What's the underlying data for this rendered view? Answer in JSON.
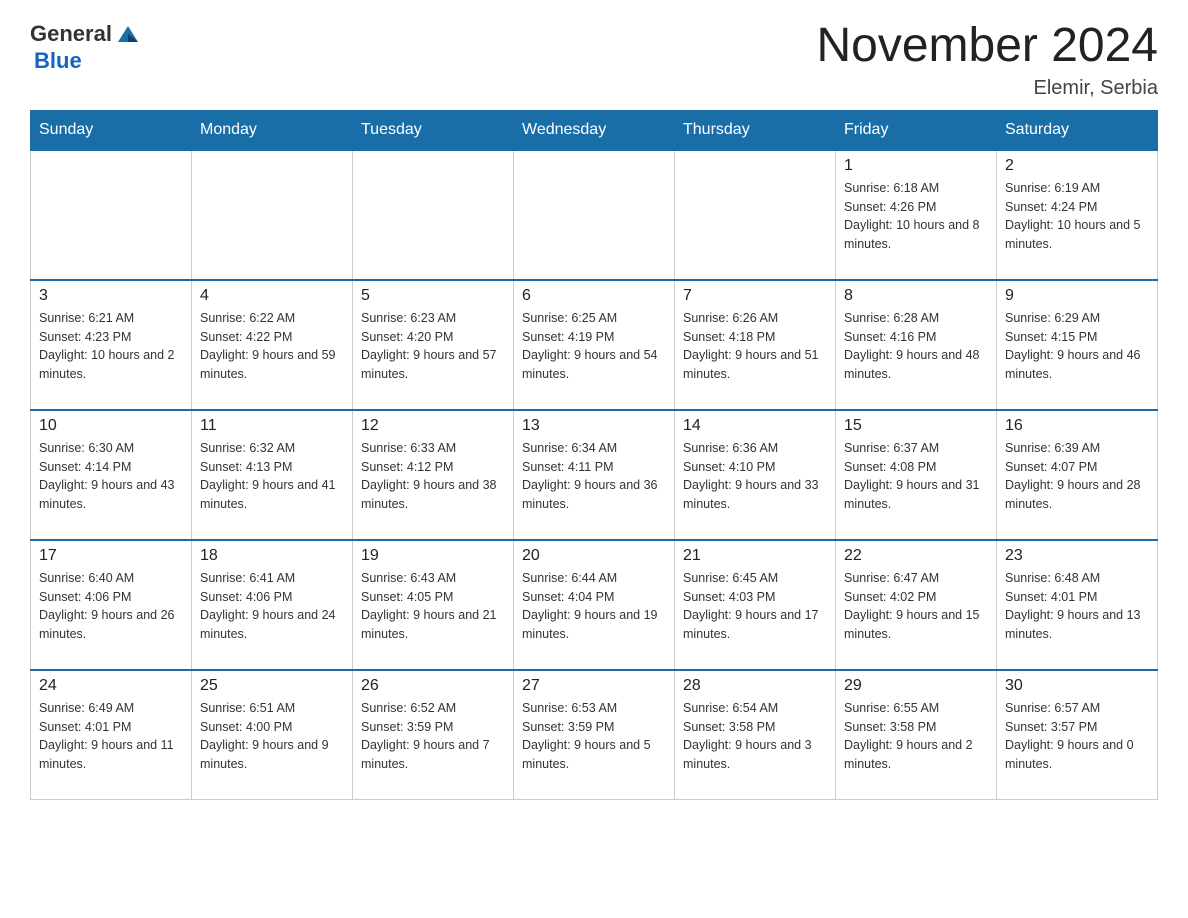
{
  "header": {
    "logo": {
      "general": "General",
      "blue": "Blue"
    },
    "title": "November 2024",
    "location": "Elemir, Serbia"
  },
  "weekdays": [
    "Sunday",
    "Monday",
    "Tuesday",
    "Wednesday",
    "Thursday",
    "Friday",
    "Saturday"
  ],
  "weeks": [
    [
      {
        "day": "",
        "info": ""
      },
      {
        "day": "",
        "info": ""
      },
      {
        "day": "",
        "info": ""
      },
      {
        "day": "",
        "info": ""
      },
      {
        "day": "",
        "info": ""
      },
      {
        "day": "1",
        "info": "Sunrise: 6:18 AM\nSunset: 4:26 PM\nDaylight: 10 hours and 8 minutes."
      },
      {
        "day": "2",
        "info": "Sunrise: 6:19 AM\nSunset: 4:24 PM\nDaylight: 10 hours and 5 minutes."
      }
    ],
    [
      {
        "day": "3",
        "info": "Sunrise: 6:21 AM\nSunset: 4:23 PM\nDaylight: 10 hours and 2 minutes."
      },
      {
        "day": "4",
        "info": "Sunrise: 6:22 AM\nSunset: 4:22 PM\nDaylight: 9 hours and 59 minutes."
      },
      {
        "day": "5",
        "info": "Sunrise: 6:23 AM\nSunset: 4:20 PM\nDaylight: 9 hours and 57 minutes."
      },
      {
        "day": "6",
        "info": "Sunrise: 6:25 AM\nSunset: 4:19 PM\nDaylight: 9 hours and 54 minutes."
      },
      {
        "day": "7",
        "info": "Sunrise: 6:26 AM\nSunset: 4:18 PM\nDaylight: 9 hours and 51 minutes."
      },
      {
        "day": "8",
        "info": "Sunrise: 6:28 AM\nSunset: 4:16 PM\nDaylight: 9 hours and 48 minutes."
      },
      {
        "day": "9",
        "info": "Sunrise: 6:29 AM\nSunset: 4:15 PM\nDaylight: 9 hours and 46 minutes."
      }
    ],
    [
      {
        "day": "10",
        "info": "Sunrise: 6:30 AM\nSunset: 4:14 PM\nDaylight: 9 hours and 43 minutes."
      },
      {
        "day": "11",
        "info": "Sunrise: 6:32 AM\nSunset: 4:13 PM\nDaylight: 9 hours and 41 minutes."
      },
      {
        "day": "12",
        "info": "Sunrise: 6:33 AM\nSunset: 4:12 PM\nDaylight: 9 hours and 38 minutes."
      },
      {
        "day": "13",
        "info": "Sunrise: 6:34 AM\nSunset: 4:11 PM\nDaylight: 9 hours and 36 minutes."
      },
      {
        "day": "14",
        "info": "Sunrise: 6:36 AM\nSunset: 4:10 PM\nDaylight: 9 hours and 33 minutes."
      },
      {
        "day": "15",
        "info": "Sunrise: 6:37 AM\nSunset: 4:08 PM\nDaylight: 9 hours and 31 minutes."
      },
      {
        "day": "16",
        "info": "Sunrise: 6:39 AM\nSunset: 4:07 PM\nDaylight: 9 hours and 28 minutes."
      }
    ],
    [
      {
        "day": "17",
        "info": "Sunrise: 6:40 AM\nSunset: 4:06 PM\nDaylight: 9 hours and 26 minutes."
      },
      {
        "day": "18",
        "info": "Sunrise: 6:41 AM\nSunset: 4:06 PM\nDaylight: 9 hours and 24 minutes."
      },
      {
        "day": "19",
        "info": "Sunrise: 6:43 AM\nSunset: 4:05 PM\nDaylight: 9 hours and 21 minutes."
      },
      {
        "day": "20",
        "info": "Sunrise: 6:44 AM\nSunset: 4:04 PM\nDaylight: 9 hours and 19 minutes."
      },
      {
        "day": "21",
        "info": "Sunrise: 6:45 AM\nSunset: 4:03 PM\nDaylight: 9 hours and 17 minutes."
      },
      {
        "day": "22",
        "info": "Sunrise: 6:47 AM\nSunset: 4:02 PM\nDaylight: 9 hours and 15 minutes."
      },
      {
        "day": "23",
        "info": "Sunrise: 6:48 AM\nSunset: 4:01 PM\nDaylight: 9 hours and 13 minutes."
      }
    ],
    [
      {
        "day": "24",
        "info": "Sunrise: 6:49 AM\nSunset: 4:01 PM\nDaylight: 9 hours and 11 minutes."
      },
      {
        "day": "25",
        "info": "Sunrise: 6:51 AM\nSunset: 4:00 PM\nDaylight: 9 hours and 9 minutes."
      },
      {
        "day": "26",
        "info": "Sunrise: 6:52 AM\nSunset: 3:59 PM\nDaylight: 9 hours and 7 minutes."
      },
      {
        "day": "27",
        "info": "Sunrise: 6:53 AM\nSunset: 3:59 PM\nDaylight: 9 hours and 5 minutes."
      },
      {
        "day": "28",
        "info": "Sunrise: 6:54 AM\nSunset: 3:58 PM\nDaylight: 9 hours and 3 minutes."
      },
      {
        "day": "29",
        "info": "Sunrise: 6:55 AM\nSunset: 3:58 PM\nDaylight: 9 hours and 2 minutes."
      },
      {
        "day": "30",
        "info": "Sunrise: 6:57 AM\nSunset: 3:57 PM\nDaylight: 9 hours and 0 minutes."
      }
    ]
  ]
}
